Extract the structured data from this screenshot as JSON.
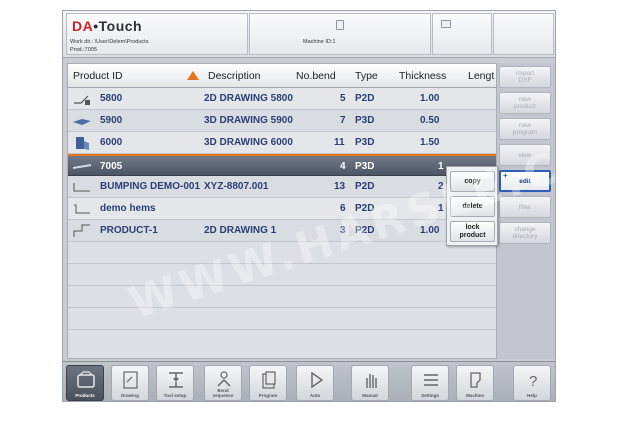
{
  "app": {
    "logo_brand": "DA",
    "logo_name": "Touch"
  },
  "header": {
    "work_dir_label": "Work dir.: \\User\\Delem\\Products",
    "product_label": "Prod.:7005",
    "machine_label": "Machine ID:1"
  },
  "table": {
    "columns": [
      "Product ID",
      "Description",
      "No.bend",
      "Type",
      "Thickness",
      "Lengt"
    ],
    "rows": [
      {
        "id": "5800",
        "description": "2D DRAWING 5800",
        "bends": "5",
        "type": "P2D",
        "thickness": "1.00",
        "thumb": "2d-drawing-icon"
      },
      {
        "id": "5900",
        "description": "3D DRAWING 5900",
        "bends": "7",
        "type": "P3D",
        "thickness": "0.50",
        "thumb": "3d-part-icon"
      },
      {
        "id": "6000",
        "description": "3D DRAWING 6000",
        "bends": "11",
        "type": "P3D",
        "thickness": "1.50",
        "thumb": "3d-part-icon"
      },
      {
        "id": "7005",
        "description": "",
        "bends": "4",
        "type": "P3D",
        "thickness": "1",
        "thumb": "3d-part-icon"
      },
      {
        "id": "BUMPING DEMO-001",
        "description": "XYZ-8807.001",
        "bends": "13",
        "type": "P2D",
        "thickness": "2",
        "thumb": "2d-profile-icon"
      },
      {
        "id": "demo hems",
        "description": "",
        "bends": "6",
        "type": "P2D",
        "thickness": "1",
        "thumb": "2d-profile-icon"
      },
      {
        "id": "PRODUCT-1",
        "description": "2D DRAWING 1",
        "bends": "3",
        "type": "P2D",
        "thickness": "1.00",
        "thumb": "2d-profile-icon"
      }
    ]
  },
  "popup": {
    "items": [
      "copy",
      "delete",
      "lock\nproduct"
    ]
  },
  "side_buttons": [
    {
      "label": "import\nDXF",
      "active": false
    },
    {
      "label": "new\nproduct",
      "active": false
    },
    {
      "label": "new\nprogram",
      "active": false
    },
    {
      "label": "view",
      "active": false
    },
    {
      "label": "edit",
      "active": true
    },
    {
      "label": "filter",
      "active": false
    },
    {
      "label": "change\ndirectory",
      "active": false
    }
  ],
  "toolbar": [
    {
      "label": "Products",
      "icon": "products-icon",
      "active": true
    },
    {
      "label": "Drawing",
      "icon": "drawing-icon",
      "active": false
    },
    {
      "label": "Tool setup",
      "icon": "tool-setup-icon",
      "active": false
    },
    {
      "label": "Bend\nsequence",
      "icon": "bend-sequence-icon",
      "active": false
    },
    {
      "label": "Program",
      "icon": "program-icon",
      "active": false
    },
    {
      "label": "Auto",
      "icon": "auto-icon",
      "active": false
    },
    {
      "label": "Manual",
      "icon": "manual-icon",
      "active": false
    },
    {
      "label": "Settings",
      "icon": "settings-icon",
      "active": false
    },
    {
      "label": "Machine",
      "icon": "machine-icon",
      "active": false
    },
    {
      "label": "Help",
      "icon": "help-icon",
      "active": false
    }
  ],
  "watermark": "WWW.HARSLE.COM",
  "colors": {
    "accent_orange": "#e8731e",
    "selected_row": "#5a6371",
    "text_blue": "#2a3f78",
    "active_border": "#2f5fb6"
  }
}
